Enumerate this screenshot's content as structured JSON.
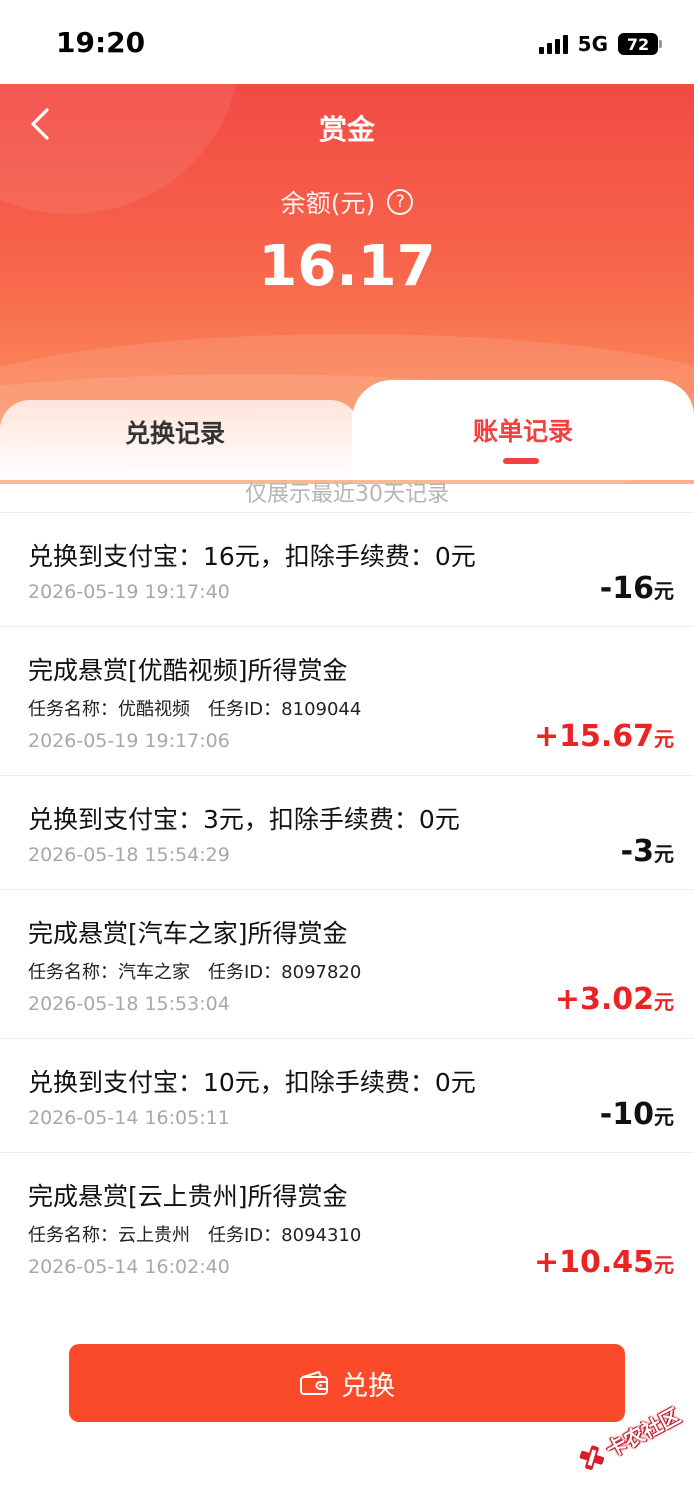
{
  "status_bar": {
    "time": "19:20",
    "network": "5G",
    "battery": "72"
  },
  "header": {
    "title": "赏金",
    "balance_label": "余额(元)",
    "balance_value": "16.17",
    "help_glyph": "?"
  },
  "tabs": [
    {
      "label": "兑换记录",
      "active": false
    },
    {
      "label": "账单记录",
      "active": true
    }
  ],
  "hint": "仅展示最近30天记录",
  "records": [
    {
      "title": "兑换到支付宝：16元，扣除手续费：0元",
      "task_name": "",
      "task_id": "",
      "time": "2026-05-19 19:17:40",
      "amount": "-16",
      "unit": "元",
      "sign": "negative"
    },
    {
      "title": "完成悬赏[优酷视频]所得赏金",
      "task_name": "任务名称：优酷视频",
      "task_id": "任务ID：8109044",
      "time": "2026-05-19 19:17:06",
      "amount": "+15.67",
      "unit": "元",
      "sign": "positive"
    },
    {
      "title": "兑换到支付宝：3元，扣除手续费：0元",
      "task_name": "",
      "task_id": "",
      "time": "2026-05-18 15:54:29",
      "amount": "-3",
      "unit": "元",
      "sign": "negative"
    },
    {
      "title": "完成悬赏[汽车之家]所得赏金",
      "task_name": "任务名称：汽车之家",
      "task_id": "任务ID：8097820",
      "time": "2026-05-18 15:53:04",
      "amount": "+3.02",
      "unit": "元",
      "sign": "positive"
    },
    {
      "title": "兑换到支付宝：10元，扣除手续费：0元",
      "task_name": "",
      "task_id": "",
      "time": "2026-05-14 16:05:11",
      "amount": "-10",
      "unit": "元",
      "sign": "negative"
    },
    {
      "title": "完成悬赏[云上贵州]所得赏金",
      "task_name": "任务名称：云上贵州",
      "task_id": "任务ID：8094310",
      "time": "2026-05-14 16:02:40",
      "amount": "+10.45",
      "unit": "元",
      "sign": "positive"
    }
  ],
  "exchange_button": {
    "label": "兑换",
    "icon": "wallet-icon"
  },
  "watermark": {
    "text": "卡农社区"
  },
  "colors": {
    "accent": "#f0433f",
    "button": "#fb4a2a",
    "positive_amount": "#ea2323",
    "negative_amount": "#111111"
  }
}
